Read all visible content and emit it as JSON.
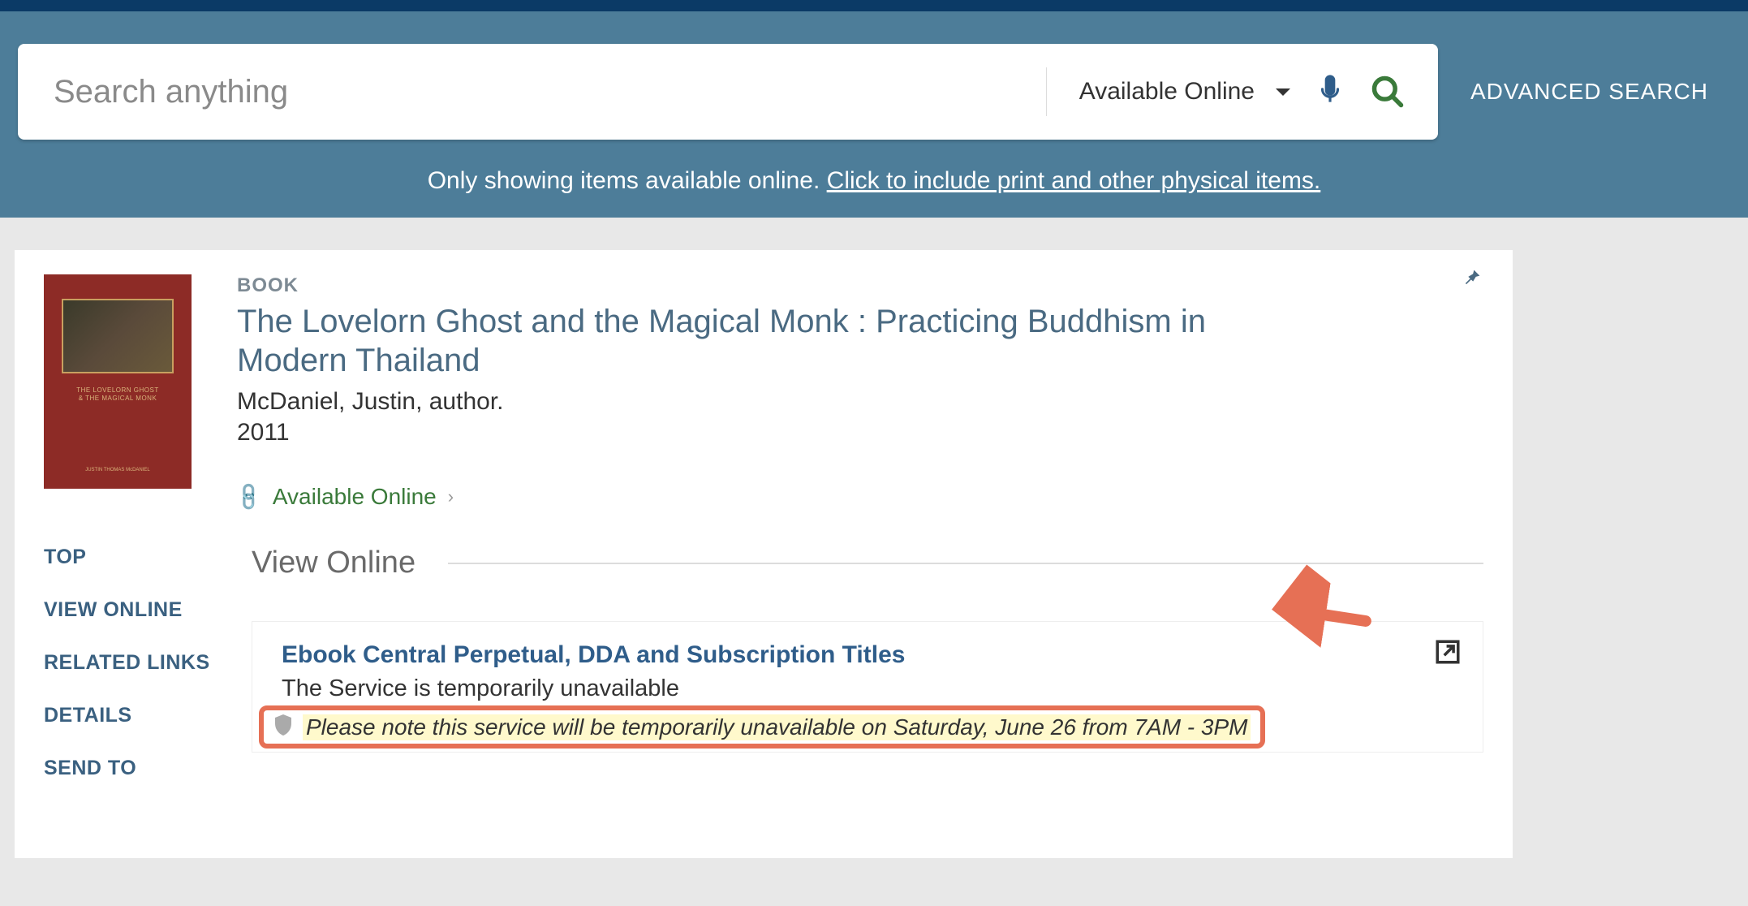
{
  "search": {
    "placeholder": "Search anything",
    "scope": "Available Online",
    "advanced_label": "ADVANCED SEARCH"
  },
  "filter_notice": {
    "prefix": "Only showing items available online. ",
    "link": "Click to include print and other physical items."
  },
  "record": {
    "type_label": "BOOK",
    "title": "The Lovelorn Ghost and the Magical Monk : Practicing Buddhism in Modern Thailand",
    "author": "McDaniel, Justin, author.",
    "year": "2011",
    "availability": "Available Online"
  },
  "sidenav": {
    "items": [
      "TOP",
      "VIEW ONLINE",
      "RELATED LINKS",
      "DETAILS",
      "SEND TO"
    ]
  },
  "section": {
    "title": "View Online"
  },
  "service": {
    "title": "Ebook Central Perpetual, DDA and Subscription Titles",
    "unavailable": "The Service is temporarily unavailable",
    "note": "Please note this service will be temporarily unavailable on Saturday, June 26 from 7AM - 3PM"
  }
}
